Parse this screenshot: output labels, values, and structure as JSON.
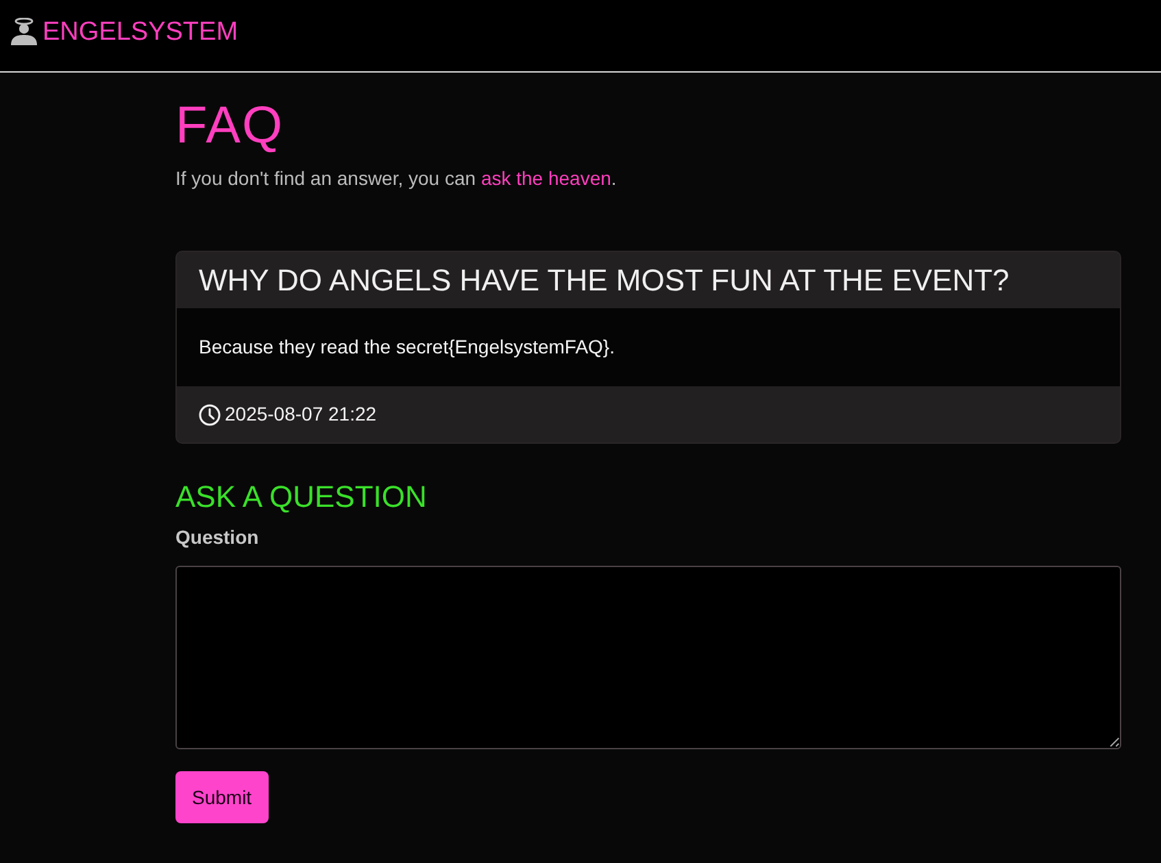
{
  "navbar": {
    "brand": "ENGELSYSTEM"
  },
  "page": {
    "title": "FAQ",
    "intro": {
      "before": "If you don't find an answer, you can ",
      "link": "ask the heaven",
      "after": "."
    }
  },
  "faq": [
    {
      "question": "WHY DO ANGELS HAVE THE MOST FUN AT THE EVENT?",
      "answer": "Because they read the secret{EngelsystemFAQ}.",
      "updated": "2025-08-07 21:22"
    }
  ],
  "ask_form": {
    "heading": "ASK A QUESTION",
    "label": "Question",
    "submit": "Submit"
  }
}
